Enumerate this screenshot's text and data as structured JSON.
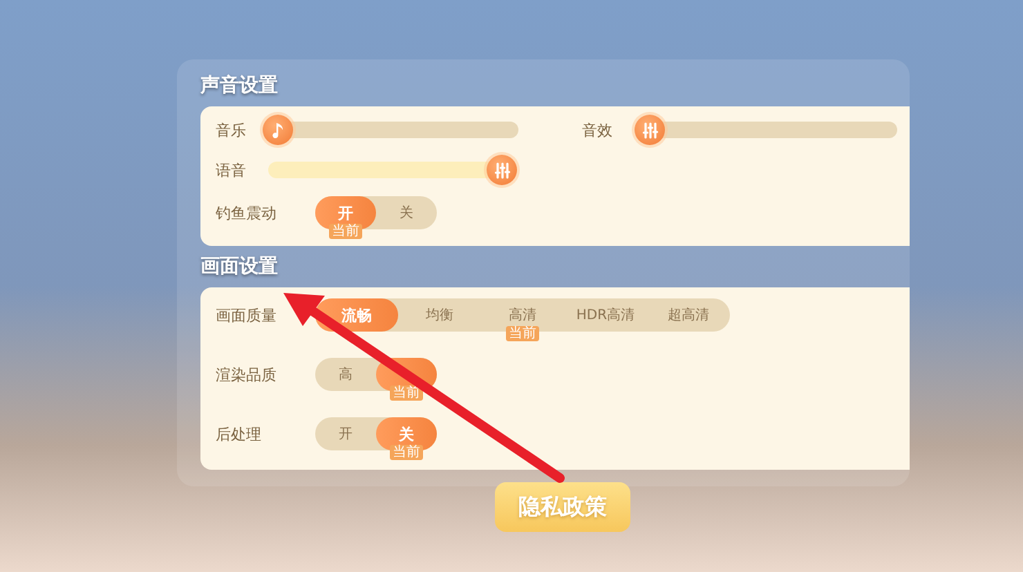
{
  "sound_settings": {
    "title": "声音设置",
    "sliders": [
      {
        "label": "音乐",
        "kind": "music",
        "level": 0
      },
      {
        "label": "音效",
        "kind": "mixer",
        "level": 0
      },
      {
        "label": "语音",
        "kind": "mixer",
        "level": 1
      }
    ],
    "toggles": [
      {
        "label": "钓鱼震动",
        "options": [
          {
            "label": "开",
            "selected": true,
            "badge": "当前"
          },
          {
            "label": "关",
            "selected": false
          }
        ]
      }
    ]
  },
  "graphics_settings": {
    "title": "画面设置",
    "rows": [
      {
        "label": "画面质量",
        "options": [
          {
            "label": "流畅",
            "selected": true
          },
          {
            "label": "均衡",
            "selected": false
          },
          {
            "label": "高清",
            "selected": false,
            "badge": "当前"
          },
          {
            "label": "HDR高清",
            "selected": false
          },
          {
            "label": "超高清",
            "selected": false
          }
        ]
      },
      {
        "label": "渲染品质",
        "options": [
          {
            "label": "高",
            "selected": false
          },
          {
            "selected": true,
            "badge": "当前"
          }
        ]
      },
      {
        "label": "后处理",
        "options": [
          {
            "label": "开",
            "selected": false
          },
          {
            "label": "关",
            "selected": true,
            "badge": "当前"
          }
        ]
      }
    ]
  },
  "privacy_button": "隐私政策"
}
